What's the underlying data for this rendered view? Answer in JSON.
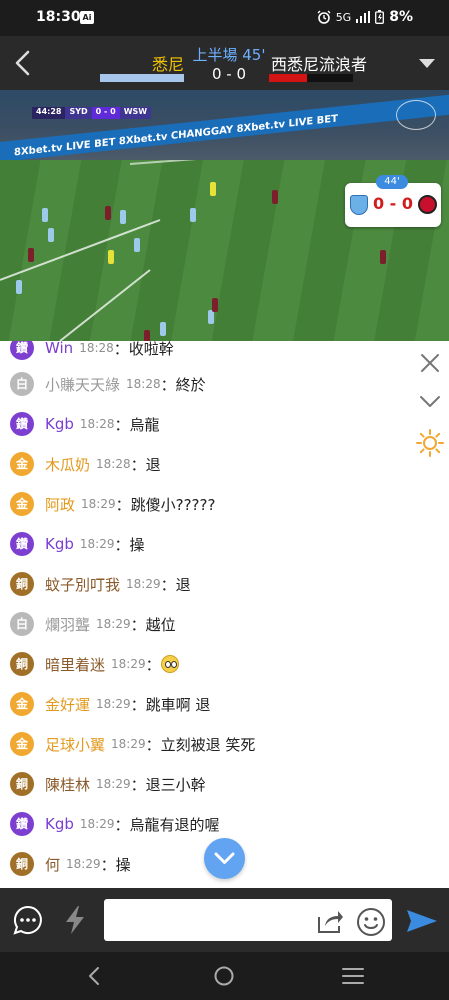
{
  "status_bar": {
    "time": "18:30",
    "ai_badge": "Ai",
    "network": "5G",
    "battery": "8%"
  },
  "match": {
    "home_team": "悉尼",
    "away_team": "西悉尼流浪者",
    "period": "上半場 45'",
    "score": "0 - 0",
    "home_color": "#a8c6ec",
    "away_color": "#d21414"
  },
  "broadcast": {
    "scorebug_clock": "44:28",
    "scorebug_home": "SYD",
    "scorebug_score": "0 - 0",
    "scorebug_away": "WSW",
    "ad_text": "8Xbet.tv   LIVE BET   8Xbet.tv   CHANGGAY   8Xbet.tv   LIVE BET",
    "card_minute": "44'",
    "card_score": "0 - 0"
  },
  "chat": {
    "messages": [
      {
        "level": "diamond",
        "badge": "鑽",
        "user": "Win",
        "time": "18:28",
        "text": "：收啦幹"
      },
      {
        "level": "white",
        "badge": "白",
        "user": "小賺天天綠",
        "time": "18:28",
        "text": "：終於"
      },
      {
        "level": "diamond",
        "badge": "鑽",
        "user": "Kgb",
        "time": "18:28",
        "text": "：烏龍"
      },
      {
        "level": "gold",
        "badge": "金",
        "user": "木瓜奶",
        "time": "18:28",
        "text": "：退"
      },
      {
        "level": "gold",
        "badge": "金",
        "user": "阿政",
        "time": "18:29",
        "text": "：跳傻小?????"
      },
      {
        "level": "diamond",
        "badge": "鑽",
        "user": "Kgb",
        "time": "18:29",
        "text": "：操"
      },
      {
        "level": "copper",
        "badge": "銅",
        "user": "蚊子別叮我",
        "time": "18:29",
        "text": "：退"
      },
      {
        "level": "white",
        "badge": "白",
        "user": "爛羽聾",
        "time": "18:29",
        "text": "：越位"
      },
      {
        "level": "copper",
        "badge": "銅",
        "user": "暗里着迷",
        "time": "18:29",
        "text": "："
      },
      {
        "level": "gold",
        "badge": "金",
        "user": "金好運",
        "time": "18:29",
        "text": "：跳車啊 退"
      },
      {
        "level": "gold",
        "badge": "金",
        "user": "足球小翼",
        "time": "18:29",
        "text": "：立刻被退 笑死"
      },
      {
        "level": "copper",
        "badge": "銅",
        "user": "陳桂林",
        "time": "18:29",
        "text": "：退三小幹"
      },
      {
        "level": "diamond",
        "badge": "鑽",
        "user": "Kgb",
        "time": "18:29",
        "text": "：烏龍有退的喔"
      },
      {
        "level": "copper",
        "badge": "銅",
        "user": "何",
        "time": "18:29",
        "text": "：操"
      }
    ]
  },
  "input": {
    "placeholder": ""
  },
  "colors": {
    "diamond": "#7d3fd0",
    "gold": "#f0a830",
    "copper": "#a07028",
    "white": "#b9b9b9",
    "accent": "#3b8be0"
  }
}
